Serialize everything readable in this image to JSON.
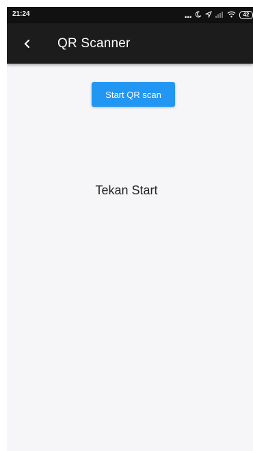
{
  "status_bar": {
    "time": "21:24",
    "dots": "...",
    "icons": [
      "moon-icon",
      "location-icon",
      "signal-icon",
      "wifi-icon",
      "battery-icon"
    ],
    "battery": "42"
  },
  "app_bar": {
    "title": "QR Scanner",
    "background": "#1c1c1c"
  },
  "main": {
    "scan_button_label": "Start QR scan",
    "scan_button_color": "#2196f3",
    "result_text": "Tekan Start"
  }
}
